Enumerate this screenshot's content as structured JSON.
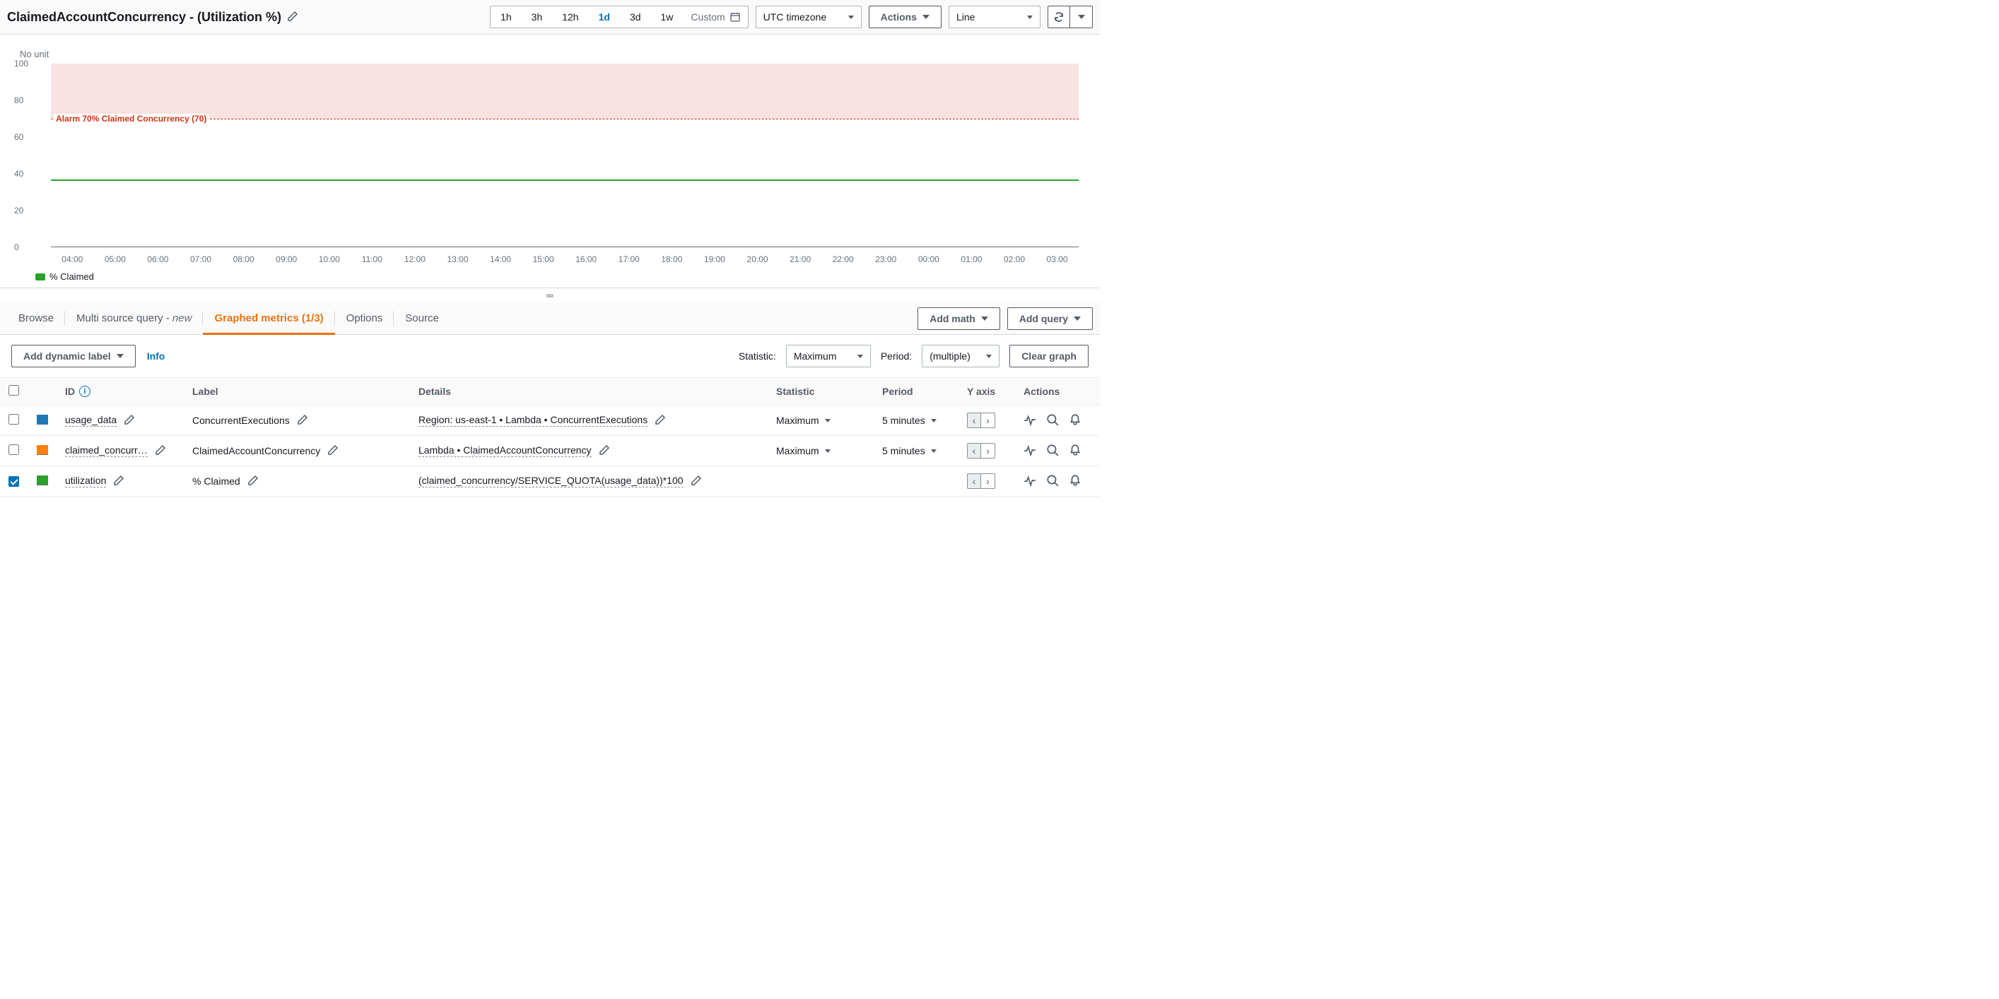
{
  "header": {
    "title": "ClaimedAccountConcurrency - (Utilization %)",
    "time_ranges": [
      "1h",
      "3h",
      "12h",
      "1d",
      "3d",
      "1w"
    ],
    "active_range": "1d",
    "custom_label": "Custom",
    "timezone": "UTC timezone",
    "actions_label": "Actions",
    "graph_type": "Line"
  },
  "chart": {
    "no_unit": "No unit",
    "alarm_label": "Alarm 70% Claimed Concurrency (70)",
    "legend_label": "% Claimed",
    "legend_color": "#2ca02c"
  },
  "chart_data": {
    "type": "line",
    "title": "ClaimedAccountConcurrency - (Utilization %)",
    "xlabel": "",
    "ylabel": "No unit",
    "ylim": [
      0,
      100
    ],
    "y_ticks": [
      0,
      20.0,
      40.0,
      60.0,
      80.0,
      100.0
    ],
    "x_ticks": [
      "04:00",
      "05:00",
      "06:00",
      "07:00",
      "08:00",
      "09:00",
      "10:00",
      "11:00",
      "12:00",
      "13:00",
      "14:00",
      "15:00",
      "16:00",
      "17:00",
      "18:00",
      "19:00",
      "20:00",
      "21:00",
      "22:00",
      "23:00",
      "00:00",
      "01:00",
      "02:00",
      "03:00"
    ],
    "alarm_threshold": 70,
    "alarm_band": [
      70,
      100
    ],
    "series": [
      {
        "name": "% Claimed",
        "color": "#2ca02c",
        "x": [
          "04:00",
          "05:00",
          "06:00",
          "07:00",
          "08:00",
          "09:00",
          "10:00",
          "11:00",
          "12:00",
          "13:00",
          "14:00",
          "15:00",
          "16:00",
          "17:00",
          "18:00",
          "19:00",
          "20:00",
          "21:00",
          "22:00",
          "23:00",
          "00:00",
          "01:00",
          "02:00",
          "03:00"
        ],
        "values": [
          37,
          37,
          37,
          37,
          37,
          37,
          37,
          37,
          37,
          37,
          37,
          37,
          37,
          37,
          37,
          37,
          37,
          37,
          37,
          37,
          37,
          37,
          37,
          37
        ]
      }
    ]
  },
  "tabs": {
    "browse": "Browse",
    "multi_source_prefix": "Multi source query - ",
    "multi_source_em": "new",
    "graphed_metrics": "Graphed metrics (1/3)",
    "options": "Options",
    "source": "Source",
    "add_math": "Add math",
    "add_query": "Add query"
  },
  "toolbar": {
    "add_dynamic_label": "Add dynamic label",
    "info": "Info",
    "statistic_label": "Statistic:",
    "statistic_value": "Maximum",
    "period_label": "Period:",
    "period_value": "(multiple)",
    "clear_graph": "Clear graph"
  },
  "table": {
    "headers": {
      "id": "ID",
      "label": "Label",
      "details": "Details",
      "statistic": "Statistic",
      "period": "Period",
      "yaxis": "Y axis",
      "actions": "Actions"
    },
    "rows": [
      {
        "checked": false,
        "color": "#1f77b4",
        "id": "usage_data",
        "id_truncated": "usage_data",
        "label": "ConcurrentExecutions",
        "details": "Region: us-east-1 • Lambda • ConcurrentExecutions",
        "statistic": "Maximum",
        "period": "5 minutes",
        "has_stat": true,
        "has_dup": true
      },
      {
        "checked": false,
        "color": "#ff7f0e",
        "id": "claimed_concurrency",
        "id_truncated": "claimed_concurr…",
        "label": "ClaimedAccountConcurrency",
        "details": "Lambda • ClaimedAccountConcurrency",
        "statistic": "Maximum",
        "period": "5 minutes",
        "has_stat": true,
        "has_dup": true
      },
      {
        "checked": true,
        "color": "#2ca02c",
        "id": "utilization",
        "id_truncated": "utilization",
        "label": "% Claimed",
        "details": "(claimed_concurrency/SERVICE_QUOTA(usage_data))*100",
        "statistic": "",
        "period": "",
        "has_stat": false,
        "has_dup": false
      }
    ]
  }
}
